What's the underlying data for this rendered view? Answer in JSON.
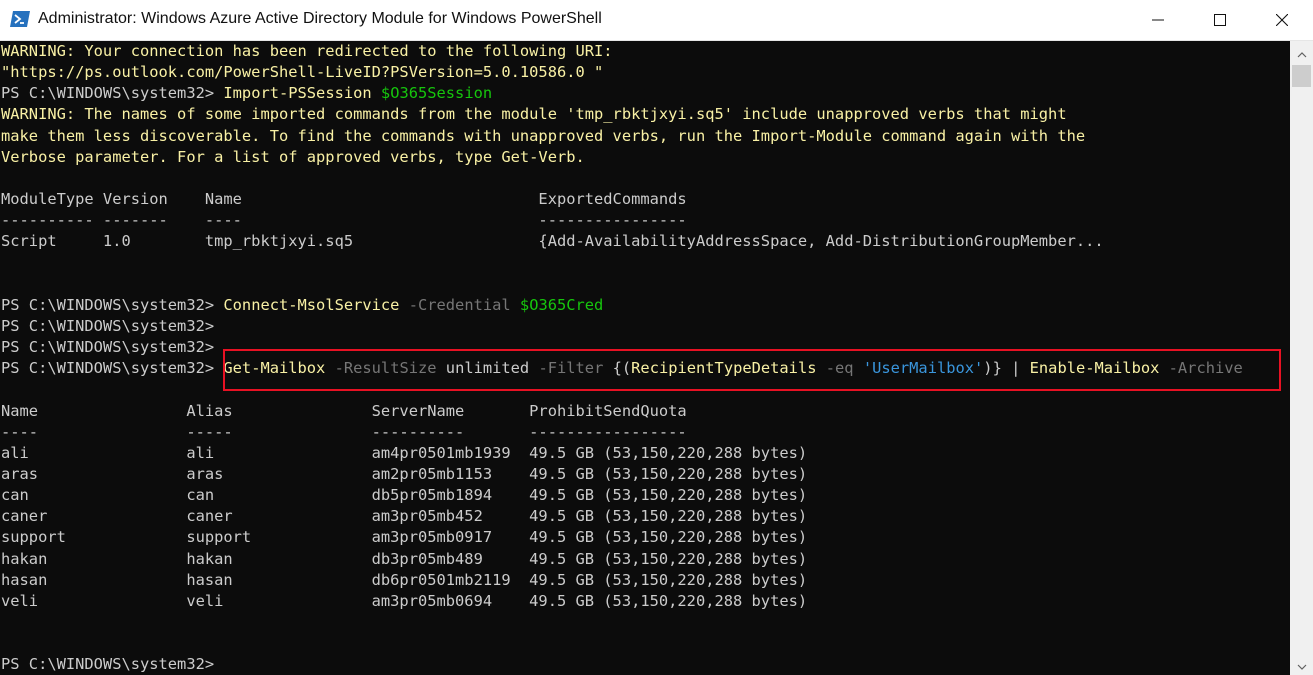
{
  "window": {
    "title": "Administrator: Windows Azure Active Directory Module for Windows PowerShell",
    "icon": "powershell-icon"
  },
  "console": {
    "lines": [
      {
        "segments": [
          {
            "t": "WARNING: Your connection has been redirected to the following URI:",
            "c": "warn"
          }
        ]
      },
      {
        "segments": [
          {
            "t": "\"https://ps.outlook.com/PowerShell-LiveID?PSVersion=5.0.10586.0 \"",
            "c": "warn"
          }
        ]
      },
      {
        "segments": [
          {
            "t": "PS C:\\WINDOWS\\system32> ",
            "c": "plain"
          },
          {
            "t": "Import-PSSession ",
            "c": "cmd"
          },
          {
            "t": "$O365Session",
            "c": "var"
          }
        ]
      },
      {
        "segments": [
          {
            "t": "WARNING: The names of some imported commands from the module 'tmp_rbktjxyi.sq5' include unapproved verbs that might",
            "c": "warn"
          }
        ]
      },
      {
        "segments": [
          {
            "t": "make them less discoverable. To find the commands with unapproved verbs, run the Import-Module command again with the",
            "c": "warn"
          }
        ]
      },
      {
        "segments": [
          {
            "t": "Verbose parameter. For a list of approved verbs, type Get-Verb.",
            "c": "warn"
          }
        ]
      },
      {
        "segments": []
      },
      {
        "segments": [
          {
            "t": "ModuleType Version    Name                                ExportedCommands",
            "c": "plain"
          }
        ]
      },
      {
        "segments": [
          {
            "t": "---------- -------    ----                                ----------------",
            "c": "plain"
          }
        ]
      },
      {
        "segments": [
          {
            "t": "Script     1.0        tmp_rbktjxyi.sq5                    {Add-AvailabilityAddressSpace, Add-DistributionGroupMember...",
            "c": "plain"
          }
        ]
      },
      {
        "segments": []
      },
      {
        "segments": []
      },
      {
        "segments": [
          {
            "t": "PS C:\\WINDOWS\\system32> ",
            "c": "plain"
          },
          {
            "t": "Connect-MsolService ",
            "c": "cmd"
          },
          {
            "t": "-Credential ",
            "c": "param"
          },
          {
            "t": "$O365Cred",
            "c": "var"
          }
        ]
      },
      {
        "segments": [
          {
            "t": "PS C:\\WINDOWS\\system32>",
            "c": "plain"
          }
        ]
      },
      {
        "segments": [
          {
            "t": "PS C:\\WINDOWS\\system32>",
            "c": "plain"
          }
        ]
      },
      {
        "segments": [
          {
            "t": "PS C:\\WINDOWS\\system32> ",
            "c": "plain"
          },
          {
            "t": "Get-Mailbox ",
            "c": "cmd"
          },
          {
            "t": "-ResultSize ",
            "c": "param"
          },
          {
            "t": "unlimited ",
            "c": "plain"
          },
          {
            "t": "-Filter ",
            "c": "param"
          },
          {
            "t": "{(",
            "c": "plain"
          },
          {
            "t": "RecipientTypeDetails ",
            "c": "cmd"
          },
          {
            "t": "-eq ",
            "c": "param"
          },
          {
            "t": "'UserMailbox'",
            "c": "str"
          },
          {
            "t": ")} | ",
            "c": "plain"
          },
          {
            "t": "Enable-Mailbox ",
            "c": "cmd"
          },
          {
            "t": "-Archive",
            "c": "param"
          }
        ]
      },
      {
        "segments": []
      },
      {
        "segments": [
          {
            "t": "Name                Alias               ServerName       ProhibitSendQuota",
            "c": "plain"
          }
        ]
      },
      {
        "segments": [
          {
            "t": "----                -----               ----------       -----------------",
            "c": "plain"
          }
        ]
      },
      {
        "segments": [
          {
            "t": "ali                 ali                 am4pr0501mb1939  49.5 GB (53,150,220,288 bytes)",
            "c": "plain"
          }
        ]
      },
      {
        "segments": [
          {
            "t": "aras                aras                am2pr05mb1153    49.5 GB (53,150,220,288 bytes)",
            "c": "plain"
          }
        ]
      },
      {
        "segments": [
          {
            "t": "can                 can                 db5pr05mb1894    49.5 GB (53,150,220,288 bytes)",
            "c": "plain"
          }
        ]
      },
      {
        "segments": [
          {
            "t": "caner               caner               am3pr05mb452     49.5 GB (53,150,220,288 bytes)",
            "c": "plain"
          }
        ]
      },
      {
        "segments": [
          {
            "t": "support             support             am3pr05mb0917    49.5 GB (53,150,220,288 bytes)",
            "c": "plain"
          }
        ]
      },
      {
        "segments": [
          {
            "t": "hakan               hakan               db3pr05mb489     49.5 GB (53,150,220,288 bytes)",
            "c": "plain"
          }
        ]
      },
      {
        "segments": [
          {
            "t": "hasan               hasan               db6pr0501mb2119  49.5 GB (53,150,220,288 bytes)",
            "c": "plain"
          }
        ]
      },
      {
        "segments": [
          {
            "t": "veli                veli                am3pr05mb0694    49.5 GB (53,150,220,288 bytes)",
            "c": "plain"
          }
        ]
      },
      {
        "segments": []
      },
      {
        "segments": []
      },
      {
        "segments": [
          {
            "t": "PS C:\\WINDOWS\\system32>",
            "c": "plain"
          }
        ]
      }
    ]
  },
  "colors": {
    "warning": "#f9f1a5",
    "command": "#f9f1a5",
    "parameter": "#767676",
    "variable": "#16c60c",
    "string": "#3a96dd",
    "highlight_border": "#e81123",
    "background": "#0c0c0c"
  }
}
